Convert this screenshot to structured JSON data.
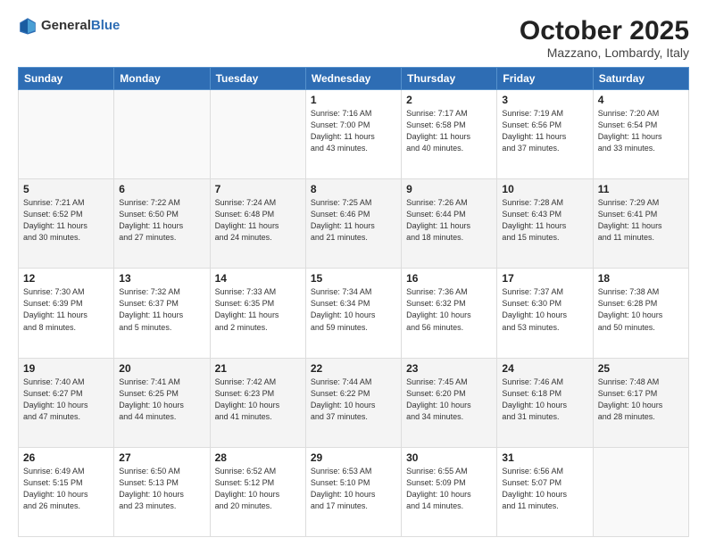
{
  "header": {
    "logo_general": "General",
    "logo_blue": "Blue",
    "month_title": "October 2025",
    "location": "Mazzano, Lombardy, Italy"
  },
  "days_of_week": [
    "Sunday",
    "Monday",
    "Tuesday",
    "Wednesday",
    "Thursday",
    "Friday",
    "Saturday"
  ],
  "weeks": [
    {
      "alt": false,
      "days": [
        {
          "num": "",
          "info": ""
        },
        {
          "num": "",
          "info": ""
        },
        {
          "num": "",
          "info": ""
        },
        {
          "num": "1",
          "info": "Sunrise: 7:16 AM\nSunset: 7:00 PM\nDaylight: 11 hours\nand 43 minutes."
        },
        {
          "num": "2",
          "info": "Sunrise: 7:17 AM\nSunset: 6:58 PM\nDaylight: 11 hours\nand 40 minutes."
        },
        {
          "num": "3",
          "info": "Sunrise: 7:19 AM\nSunset: 6:56 PM\nDaylight: 11 hours\nand 37 minutes."
        },
        {
          "num": "4",
          "info": "Sunrise: 7:20 AM\nSunset: 6:54 PM\nDaylight: 11 hours\nand 33 minutes."
        }
      ]
    },
    {
      "alt": true,
      "days": [
        {
          "num": "5",
          "info": "Sunrise: 7:21 AM\nSunset: 6:52 PM\nDaylight: 11 hours\nand 30 minutes."
        },
        {
          "num": "6",
          "info": "Sunrise: 7:22 AM\nSunset: 6:50 PM\nDaylight: 11 hours\nand 27 minutes."
        },
        {
          "num": "7",
          "info": "Sunrise: 7:24 AM\nSunset: 6:48 PM\nDaylight: 11 hours\nand 24 minutes."
        },
        {
          "num": "8",
          "info": "Sunrise: 7:25 AM\nSunset: 6:46 PM\nDaylight: 11 hours\nand 21 minutes."
        },
        {
          "num": "9",
          "info": "Sunrise: 7:26 AM\nSunset: 6:44 PM\nDaylight: 11 hours\nand 18 minutes."
        },
        {
          "num": "10",
          "info": "Sunrise: 7:28 AM\nSunset: 6:43 PM\nDaylight: 11 hours\nand 15 minutes."
        },
        {
          "num": "11",
          "info": "Sunrise: 7:29 AM\nSunset: 6:41 PM\nDaylight: 11 hours\nand 11 minutes."
        }
      ]
    },
    {
      "alt": false,
      "days": [
        {
          "num": "12",
          "info": "Sunrise: 7:30 AM\nSunset: 6:39 PM\nDaylight: 11 hours\nand 8 minutes."
        },
        {
          "num": "13",
          "info": "Sunrise: 7:32 AM\nSunset: 6:37 PM\nDaylight: 11 hours\nand 5 minutes."
        },
        {
          "num": "14",
          "info": "Sunrise: 7:33 AM\nSunset: 6:35 PM\nDaylight: 11 hours\nand 2 minutes."
        },
        {
          "num": "15",
          "info": "Sunrise: 7:34 AM\nSunset: 6:34 PM\nDaylight: 10 hours\nand 59 minutes."
        },
        {
          "num": "16",
          "info": "Sunrise: 7:36 AM\nSunset: 6:32 PM\nDaylight: 10 hours\nand 56 minutes."
        },
        {
          "num": "17",
          "info": "Sunrise: 7:37 AM\nSunset: 6:30 PM\nDaylight: 10 hours\nand 53 minutes."
        },
        {
          "num": "18",
          "info": "Sunrise: 7:38 AM\nSunset: 6:28 PM\nDaylight: 10 hours\nand 50 minutes."
        }
      ]
    },
    {
      "alt": true,
      "days": [
        {
          "num": "19",
          "info": "Sunrise: 7:40 AM\nSunset: 6:27 PM\nDaylight: 10 hours\nand 47 minutes."
        },
        {
          "num": "20",
          "info": "Sunrise: 7:41 AM\nSunset: 6:25 PM\nDaylight: 10 hours\nand 44 minutes."
        },
        {
          "num": "21",
          "info": "Sunrise: 7:42 AM\nSunset: 6:23 PM\nDaylight: 10 hours\nand 41 minutes."
        },
        {
          "num": "22",
          "info": "Sunrise: 7:44 AM\nSunset: 6:22 PM\nDaylight: 10 hours\nand 37 minutes."
        },
        {
          "num": "23",
          "info": "Sunrise: 7:45 AM\nSunset: 6:20 PM\nDaylight: 10 hours\nand 34 minutes."
        },
        {
          "num": "24",
          "info": "Sunrise: 7:46 AM\nSunset: 6:18 PM\nDaylight: 10 hours\nand 31 minutes."
        },
        {
          "num": "25",
          "info": "Sunrise: 7:48 AM\nSunset: 6:17 PM\nDaylight: 10 hours\nand 28 minutes."
        }
      ]
    },
    {
      "alt": false,
      "days": [
        {
          "num": "26",
          "info": "Sunrise: 6:49 AM\nSunset: 5:15 PM\nDaylight: 10 hours\nand 26 minutes."
        },
        {
          "num": "27",
          "info": "Sunrise: 6:50 AM\nSunset: 5:13 PM\nDaylight: 10 hours\nand 23 minutes."
        },
        {
          "num": "28",
          "info": "Sunrise: 6:52 AM\nSunset: 5:12 PM\nDaylight: 10 hours\nand 20 minutes."
        },
        {
          "num": "29",
          "info": "Sunrise: 6:53 AM\nSunset: 5:10 PM\nDaylight: 10 hours\nand 17 minutes."
        },
        {
          "num": "30",
          "info": "Sunrise: 6:55 AM\nSunset: 5:09 PM\nDaylight: 10 hours\nand 14 minutes."
        },
        {
          "num": "31",
          "info": "Sunrise: 6:56 AM\nSunset: 5:07 PM\nDaylight: 10 hours\nand 11 minutes."
        },
        {
          "num": "",
          "info": ""
        }
      ]
    }
  ]
}
